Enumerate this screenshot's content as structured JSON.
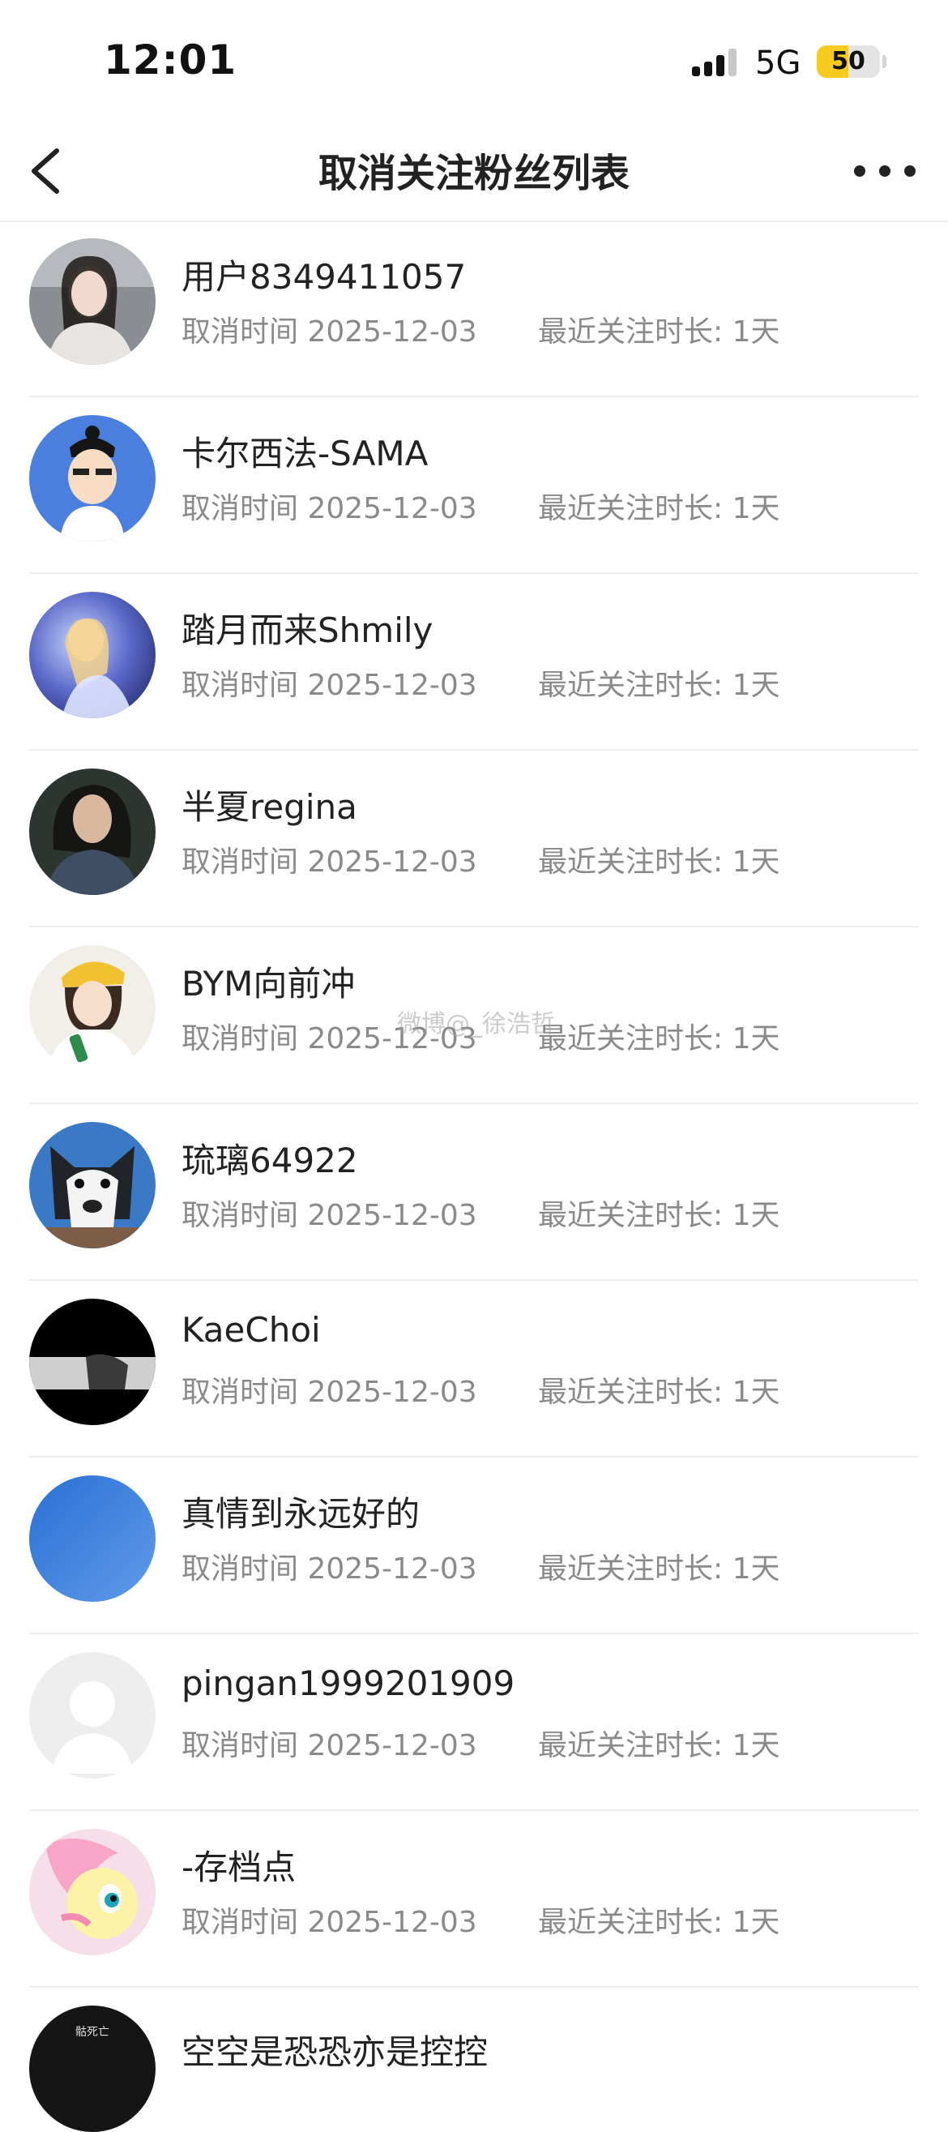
{
  "status_bar": {
    "time": "12:01",
    "network": "5G",
    "battery": "50",
    "battery_level": 0.5
  },
  "nav": {
    "title": "取消关注粉丝列表"
  },
  "list": {
    "items": [
      {
        "name": "用户8349411057",
        "cancel_time": "取消时间 2025-12-03",
        "duration": "最近关注时长: 1天"
      },
      {
        "name": "卡尔西法-SAMA",
        "cancel_time": "取消时间 2025-12-03",
        "duration": "最近关注时长: 1天"
      },
      {
        "name": "踏月而来Shmily",
        "cancel_time": "取消时间 2025-12-03",
        "duration": "最近关注时长: 1天"
      },
      {
        "name": "半夏regina",
        "cancel_time": "取消时间 2025-12-03",
        "duration": "最近关注时长: 1天"
      },
      {
        "name": "BYM向前冲",
        "cancel_time": "取消时间 2025-12-03",
        "duration": "最近关注时长: 1天"
      },
      {
        "name": "琉璃64922",
        "cancel_time": "取消时间 2025-12-03",
        "duration": "最近关注时长: 1天"
      },
      {
        "name": "KaeChoi",
        "cancel_time": "取消时间 2025-12-03",
        "duration": "最近关注时长: 1天"
      },
      {
        "name": "真情到永远好的",
        "cancel_time": "取消时间 2025-12-03",
        "duration": "最近关注时长: 1天"
      },
      {
        "name": "pingan1999201909",
        "cancel_time": "取消时间 2025-12-03",
        "duration": "最近关注时长: 1天"
      },
      {
        "name": "-存档点",
        "cancel_time": "取消时间 2025-12-03",
        "duration": "最近关注时长: 1天"
      },
      {
        "name": "空空是恐恐亦是控控",
        "avatar_text": "骷死亡"
      }
    ]
  },
  "watermark": "微博@_徐浩哲",
  "colors": {
    "text_primary": "#222222",
    "text_secondary": "#8a8a8a",
    "divider": "#ededed",
    "battery_fill": "#f7cc1f"
  }
}
